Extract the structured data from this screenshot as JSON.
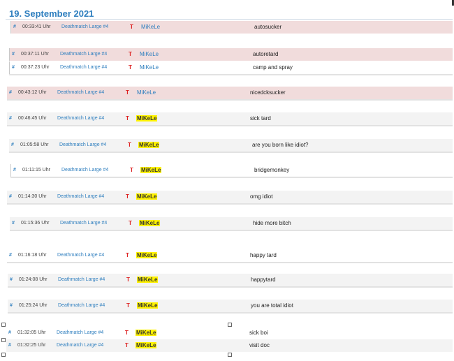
{
  "date": "19. September 2021",
  "hash": "#",
  "team": "T",
  "rows": [
    {
      "time": "00:33:41 Uhr",
      "map": "Deathmatch Large #4",
      "player": "MiKeLe",
      "message": "autosucker"
    },
    {
      "time": "00:37:11 Uhr",
      "map": "Deathmatch Large #4",
      "player": "MiKeLe",
      "message": "autoretard"
    },
    {
      "time": "00:37:23 Uhr",
      "map": "Deathmatch Large #4",
      "player": "MiKeLe",
      "message": "camp and spray"
    },
    {
      "time": "00:43:12 Uhr",
      "map": "Deathmatch Large #4",
      "player": "MiKeLe",
      "message": "nicedcksucker"
    },
    {
      "time": "00:46:45 Uhr",
      "map": "Deathmatch Large #4",
      "player": "MiKeLe",
      "message": "sick tard"
    },
    {
      "time": "01:05:58 Uhr",
      "map": "Deathmatch Large #4",
      "player": "MiKeLe",
      "message": "are you born like idiot?"
    },
    {
      "time": "01:11:15 Uhr",
      "map": "Deathmatch Large #4",
      "player": "MiKeLe",
      "message": "bridgemonkey"
    },
    {
      "time": "01:14:30 Uhr",
      "map": "Deathmatch Large #4",
      "player": "MiKeLe",
      "message": "omg idiot"
    },
    {
      "time": "01:15:36 Uhr",
      "map": "Deathmatch Large #4",
      "player": "MiKeLe",
      "message": "hide more bitch"
    },
    {
      "time": "01:16:18 Uhr",
      "map": "Deathmatch Large #4",
      "player": "MiKeLe",
      "message": "happy tard"
    },
    {
      "time": "01:24:08 Uhr",
      "map": "Deathmatch Large #4",
      "player": "MiKeLe",
      "message": "happytard"
    },
    {
      "time": "01:25:24 Uhr",
      "map": "Deathmatch Large #4",
      "player": "MiKeLe",
      "message": "you are total idiot"
    },
    {
      "time": "01:32:05 Uhr",
      "map": "Deathmatch Large #4",
      "player": "MiKeLe",
      "message": "sick boi"
    },
    {
      "time": "01:32:25 Uhr",
      "map": "Deathmatch Large #4",
      "player": "MiKeLe",
      "message": "visit doc"
    }
  ]
}
